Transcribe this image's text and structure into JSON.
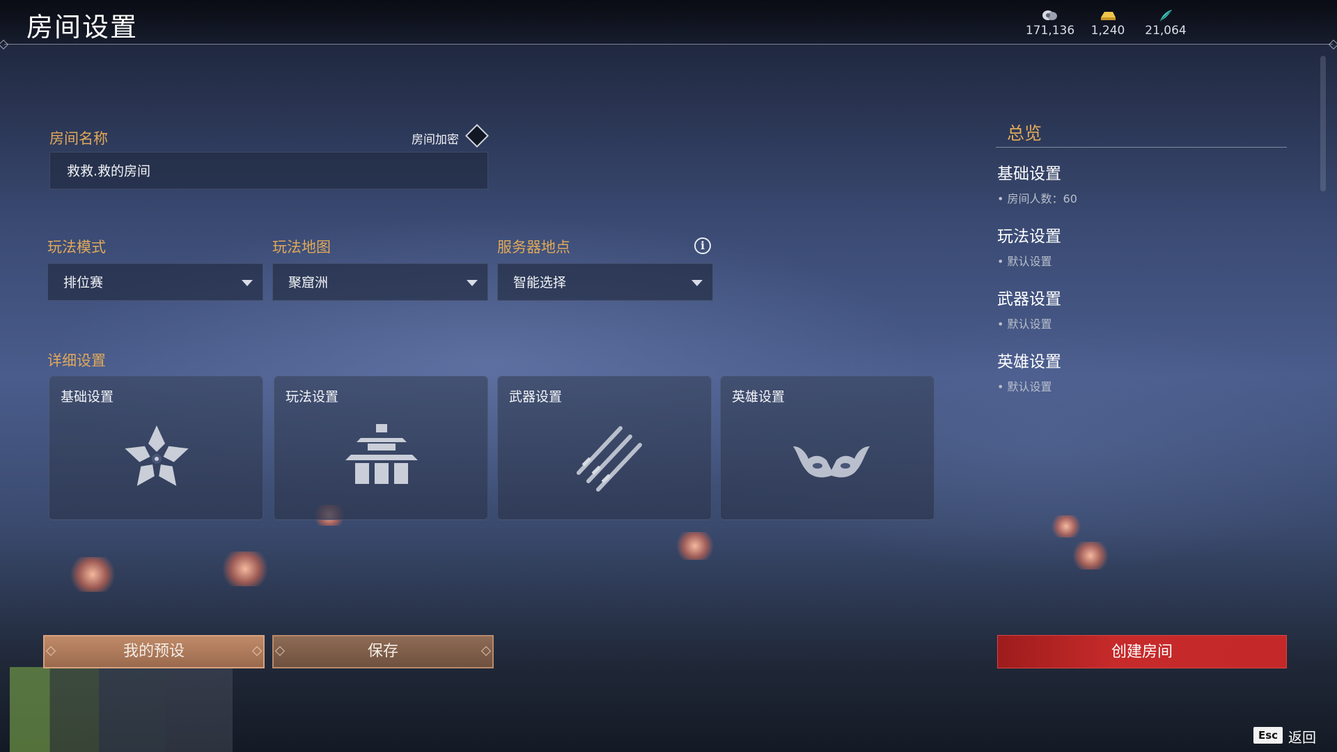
{
  "header": {
    "title": "房间设置",
    "currencies": [
      {
        "icon": "coin-stack-icon",
        "value": "171,136"
      },
      {
        "icon": "gold-ingot-icon",
        "value": "1,240"
      },
      {
        "icon": "jade-feather-icon",
        "value": "21,064"
      }
    ]
  },
  "room": {
    "name_label": "房间名称",
    "name_value": "救救.救的房间",
    "lock_label": "房间加密",
    "lock_enabled": false
  },
  "selects": {
    "mode": {
      "label": "玩法模式",
      "value": "排位赛"
    },
    "map": {
      "label": "玩法地图",
      "value": "聚窟洲"
    },
    "server": {
      "label": "服务器地点",
      "value": "智能选择"
    }
  },
  "details": {
    "label": "详细设置",
    "cards": [
      {
        "label": "基础设置",
        "icon": "flower-icon"
      },
      {
        "label": "玩法设置",
        "icon": "pagoda-icon"
      },
      {
        "label": "武器设置",
        "icon": "crossed-blades-icon"
      },
      {
        "label": "英雄设置",
        "icon": "demon-mask-icon"
      }
    ]
  },
  "overview": {
    "title": "总览",
    "sections": [
      {
        "heading": "基础设置",
        "item": "房间人数：60"
      },
      {
        "heading": "玩法设置",
        "item": "默认设置"
      },
      {
        "heading": "武器设置",
        "item": "默认设置"
      },
      {
        "heading": "英雄设置",
        "item": "默认设置"
      }
    ]
  },
  "buttons": {
    "presets": "我的预设",
    "save": "保存",
    "create": "创建房间"
  },
  "footer": {
    "esc_key": "Esc",
    "back_label": "返回"
  },
  "colors": {
    "accent_gold": "#e0a95a",
    "create_red": "#c42828",
    "preset_brown": "#b07a5c"
  }
}
